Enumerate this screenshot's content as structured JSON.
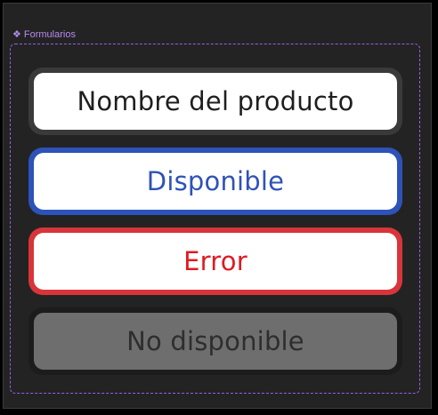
{
  "component": {
    "label": "Formularios",
    "icon": "component-diamond-icon"
  },
  "fields": [
    {
      "state": "default",
      "text": "Nombre del producto",
      "border_color": "#3a3a3a",
      "text_color": "#1f1f1f"
    },
    {
      "state": "available",
      "text": "Disponible",
      "border_color": "#2d52b8",
      "text_color": "#2f52b6"
    },
    {
      "state": "error",
      "text": "Error",
      "border_color": "#d8353b",
      "text_color": "#e01b22"
    },
    {
      "state": "disabled",
      "text": "No disponible",
      "border_color": "#1c1c1c",
      "text_color": "#2e2e2e"
    }
  ],
  "colors": {
    "canvas": "#232323",
    "selection_accent": "#9b5de5"
  }
}
